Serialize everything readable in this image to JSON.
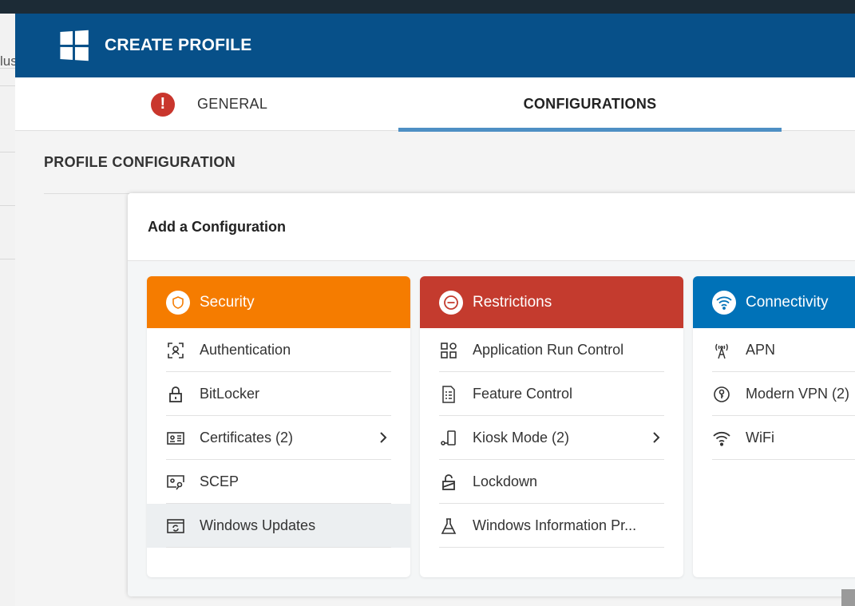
{
  "background": {
    "partial_text": "lus"
  },
  "header": {
    "title": "CREATE PROFILE",
    "logo_icon": "windows-logo-icon"
  },
  "tabs": [
    {
      "label": "GENERAL",
      "has_error": true,
      "error_glyph": "!"
    },
    {
      "label": "CONFIGURATIONS",
      "active": true
    }
  ],
  "section_title": "PROFILE CONFIGURATION",
  "panel": {
    "title": "Add a Configuration"
  },
  "cards": {
    "security": {
      "title": "Security",
      "color": "#f57c00",
      "icon": "shield-icon",
      "items": [
        {
          "label": "Authentication",
          "icon": "face-scan-icon"
        },
        {
          "label": "BitLocker",
          "icon": "lock-icon"
        },
        {
          "label": "Certificates (2)",
          "icon": "certificate-icon",
          "has_submenu": true
        },
        {
          "label": "SCEP",
          "icon": "key-card-icon"
        },
        {
          "label": "Windows Updates",
          "icon": "window-refresh-icon",
          "selected": true
        }
      ]
    },
    "restrictions": {
      "title": "Restrictions",
      "color": "#c43b2e",
      "icon": "no-entry-icon",
      "items": [
        {
          "label": "Application Run Control",
          "icon": "apps-grid-icon"
        },
        {
          "label": "Feature Control",
          "icon": "checklist-icon"
        },
        {
          "label": "Kiosk Mode (2)",
          "icon": "kiosk-device-icon",
          "has_submenu": true
        },
        {
          "label": "Lockdown",
          "icon": "open-lock-icon"
        },
        {
          "label": "Windows Information Pr...",
          "icon": "flask-icon"
        }
      ]
    },
    "connectivity": {
      "title": "Connectivity",
      "color": "#0072b8",
      "icon": "wifi-icon",
      "items": [
        {
          "label": "APN",
          "icon": "antenna-icon"
        },
        {
          "label": "Modern VPN (2)",
          "icon": "vpn-key-icon"
        },
        {
          "label": "WiFi",
          "icon": "wifi-icon"
        }
      ]
    }
  }
}
